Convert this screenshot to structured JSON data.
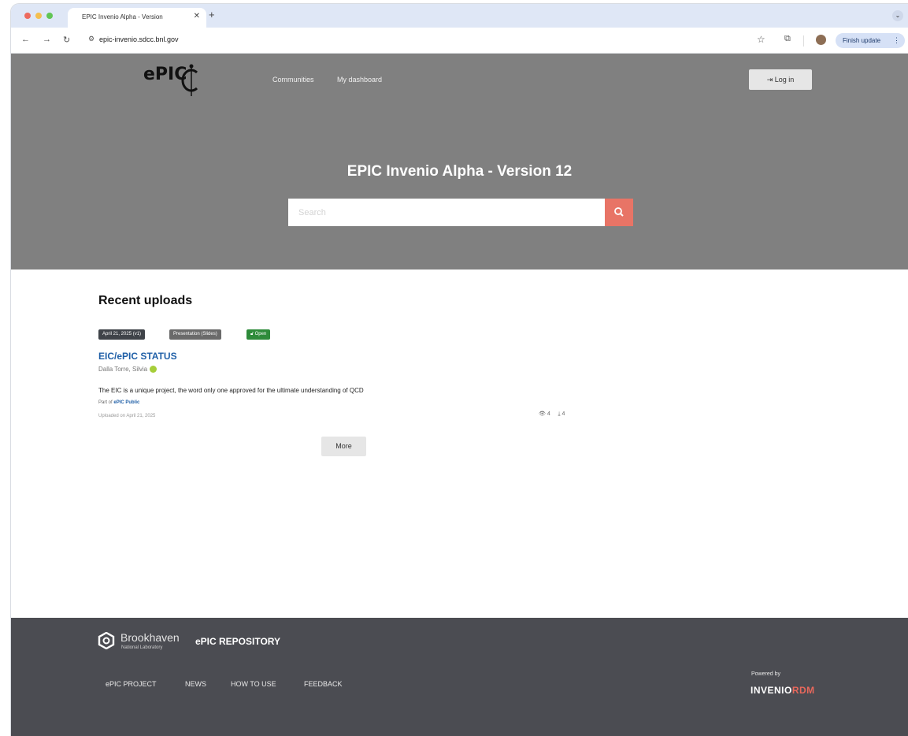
{
  "browser": {
    "tab_title": "EPIC Invenio Alpha - Version",
    "address": "epic-invenio.sdcc.bnl.gov",
    "update_label": "Finish update"
  },
  "header": {
    "logo_text": "ePIC",
    "nav": [
      "Communities",
      "My dashboard"
    ],
    "login_label": "Log in",
    "title": "EPIC Invenio Alpha - Version 12",
    "search_placeholder": "Search"
  },
  "main": {
    "section_title": "Recent uploads",
    "record": {
      "badges": [
        "April 21, 2025 (v1)",
        "Presentation (Slides)",
        "Open"
      ],
      "title": "EIC/ePIC STATUS",
      "author": "Dalla Torre, Silvia",
      "description": "The EIC is a unique project, the word only one approved for the ultimate understanding of QCD",
      "part_of_prefix": "Part of",
      "community": "ePIC Public",
      "uploaded": "Uploaded on April 21, 2025",
      "views": "4",
      "downloads": "4"
    },
    "more_label": "More"
  },
  "footer": {
    "org_name": "Brookhaven",
    "org_sub": "National Laboratory",
    "repo_name": "ePIC REPOSITORY",
    "links": [
      "ePIC PROJECT",
      "NEWS",
      "HOW TO USE",
      "FEEDBACK"
    ],
    "powered_by": "Powered by",
    "invenio": "INVENIO",
    "rdm": "RDM"
  },
  "colors": {
    "hero_bg": "#808080",
    "search_accent": "#e87466",
    "link": "#1f5fa7",
    "open_badge": "#2e8b3a",
    "footer_bg": "#4b4c52"
  }
}
